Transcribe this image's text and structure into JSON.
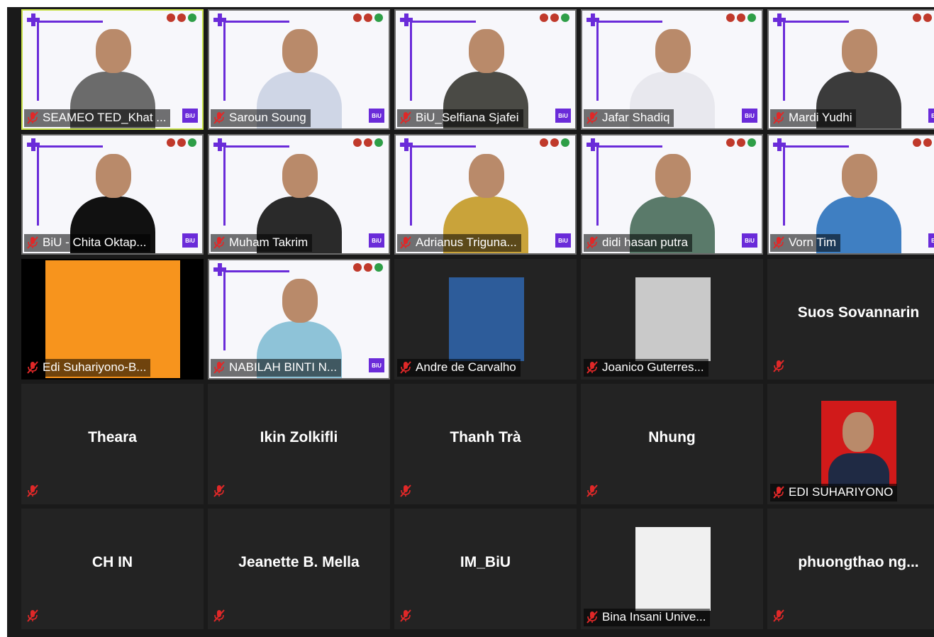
{
  "tiles": [
    {
      "name": "SEAMEO TED_Khat ...",
      "kind": "video",
      "active": true,
      "shirt": "#6b6b6b"
    },
    {
      "name": "Saroun Soung",
      "kind": "video",
      "shirt": "#cfd6e6"
    },
    {
      "name": "BiU_Selfiana Sjafei",
      "kind": "video",
      "shirt": "#4a4a45"
    },
    {
      "name": "Jafar Shadiq",
      "kind": "video",
      "shirt": "#e8e8ee"
    },
    {
      "name": "Mardi Yudhi",
      "kind": "video",
      "shirt": "#3b3b3b"
    },
    {
      "name": "BiU - Chita Oktap...",
      "kind": "video",
      "shirt": "#111111"
    },
    {
      "name": "Muham Takrim",
      "kind": "video",
      "shirt": "#2a2a2a"
    },
    {
      "name": "Adrianus Triguna...",
      "kind": "video",
      "shirt": "#c9a33a"
    },
    {
      "name": "didi hasan putra",
      "kind": "video",
      "shirt": "#5a7a6a"
    },
    {
      "name": "Vorn Tim",
      "kind": "video",
      "shirt": "#3f7fc2"
    },
    {
      "name": "Edi Suhariyono-B...",
      "kind": "orange"
    },
    {
      "name": "NABILAH BINTI N...",
      "kind": "video",
      "shirt": "#8ec3d8"
    },
    {
      "name": "Andre de Carvalho",
      "kind": "photo",
      "thumb_color": "#2d5c9a"
    },
    {
      "name": "Joanico Guterres...",
      "kind": "photo",
      "thumb_color": "#c9c9c9"
    },
    {
      "name": "Suos Sovannarin",
      "kind": "name"
    },
    {
      "name": "Theara",
      "kind": "name"
    },
    {
      "name": "Ikin Zolkifli",
      "kind": "name"
    },
    {
      "name": "Thanh Trà",
      "kind": "name"
    },
    {
      "name": "Nhung",
      "kind": "name"
    },
    {
      "name": "EDI SUHARIYONO",
      "kind": "photo-large",
      "thumb_color": "#d11a1a"
    },
    {
      "name": "CH IN",
      "kind": "name"
    },
    {
      "name": "Jeanette B. Mella",
      "kind": "name"
    },
    {
      "name": "IM_BiU",
      "kind": "name"
    },
    {
      "name": "Bina Insani Unive...",
      "kind": "photo",
      "thumb_color": "#f0f0f0"
    },
    {
      "name": "phuongthao  ng...",
      "kind": "name"
    }
  ],
  "colors": {
    "active_border": "#c8e14a",
    "tile_background": "#232323",
    "muted_mic": "#e02828",
    "slide_accent": "#6a2bd9",
    "orange_tile": "#f7941d"
  },
  "icons": {
    "muted": "muted-mic-icon"
  }
}
